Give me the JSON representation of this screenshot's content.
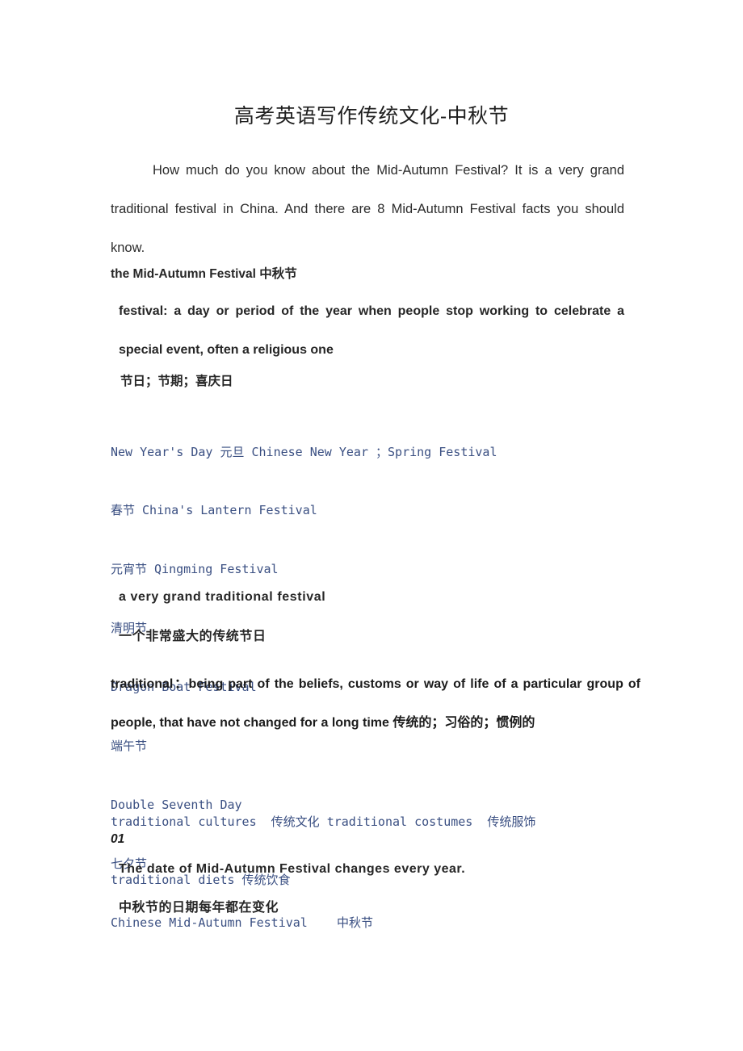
{
  "document": {
    "title": "高考英语写作传统文化-中秋节",
    "intro_paragraph": "How much do you know about the Mid-Autumn Festival? It is a very grand traditional festival in China. And there are 8 Mid-Autumn Festival facts you should know."
  },
  "festival_section": {
    "heading": "the Mid-Autumn Festival 中秋节",
    "definition": "festival: a day or period of the year when people stop working to celebrate a special event, often a religious one",
    "chinese_meaning": "节日；节期；喜庆日",
    "festival_list": [
      "New Year's Day 元旦 Chinese New Year ；Spring Festival",
      "春节 China's Lantern Festival",
      "元宵节 Qingming Festival",
      "清明节",
      "Dragon Boat Festival",
      "端午节",
      "Double Seventh Day",
      "七夕节",
      "Chinese Mid-Autumn Festival    中秋节"
    ]
  },
  "traditional_section": {
    "phrase_en": "a very grand traditional festival",
    "phrase_cn": "一个非常盛大的传统节日",
    "definition": "traditional：being part of the beliefs, customs or way of life of a particular group of people, that have not changed for a long time 传统的；习俗的；惯例的",
    "collocations": [
      "traditional cultures  传统文化 traditional costumes  传统服饰",
      "traditional diets 传统饮食"
    ]
  },
  "fact_items": [
    {
      "number": "01",
      "english": "The date of Mid-Autumn Festival changes every year.",
      "chinese": "中秋节的日期每年都在变化"
    }
  ],
  "colors": {
    "body_text": "#2b2b2b",
    "heading_text": "#1f1f1f",
    "accent_blue": "#3a4f82",
    "page_background": "#ffffff"
  }
}
